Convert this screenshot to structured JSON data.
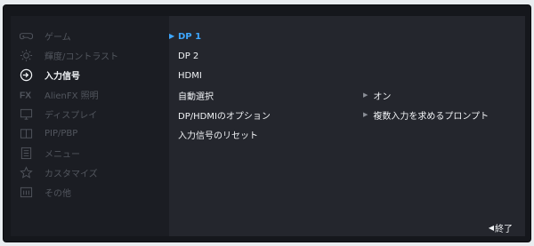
{
  "sidebar": {
    "items": [
      {
        "label": "ゲーム",
        "icon": "gamepad-icon",
        "active": false
      },
      {
        "label": "輝度/コントラスト",
        "icon": "brightness-icon",
        "active": false
      },
      {
        "label": "入力信号",
        "icon": "input-icon",
        "active": true
      },
      {
        "label": "AlienFX 照明",
        "icon": "fx-icon",
        "active": false
      },
      {
        "label": "ディスプレイ",
        "icon": "monitor-icon",
        "active": false
      },
      {
        "label": "PIP/PBP",
        "icon": "pip-icon",
        "active": false
      },
      {
        "label": "メニュー",
        "icon": "menu-icon",
        "active": false
      },
      {
        "label": "カスタマイズ",
        "icon": "star-icon",
        "active": false
      },
      {
        "label": "その他",
        "icon": "info-icon",
        "active": false
      }
    ]
  },
  "content": {
    "items": [
      {
        "label": "DP 1",
        "selected": true
      },
      {
        "label": "DP 2",
        "selected": false
      },
      {
        "label": "HDMI",
        "selected": false
      },
      {
        "label": "自動選択",
        "selected": false,
        "value": "オン"
      },
      {
        "label": "DP/HDMIのオプション",
        "selected": false,
        "value": "複数入力を求めるプロンプト"
      },
      {
        "label": "入力信号のリセット",
        "selected": false
      }
    ],
    "selected_marker": "▶",
    "value_marker": "▶"
  },
  "footer": {
    "exit_marker": "◀",
    "exit_label": "終了"
  },
  "colors": {
    "accent": "#3ea7ff",
    "active_text": "#f2f4f7",
    "inactive_text": "#52565e"
  }
}
